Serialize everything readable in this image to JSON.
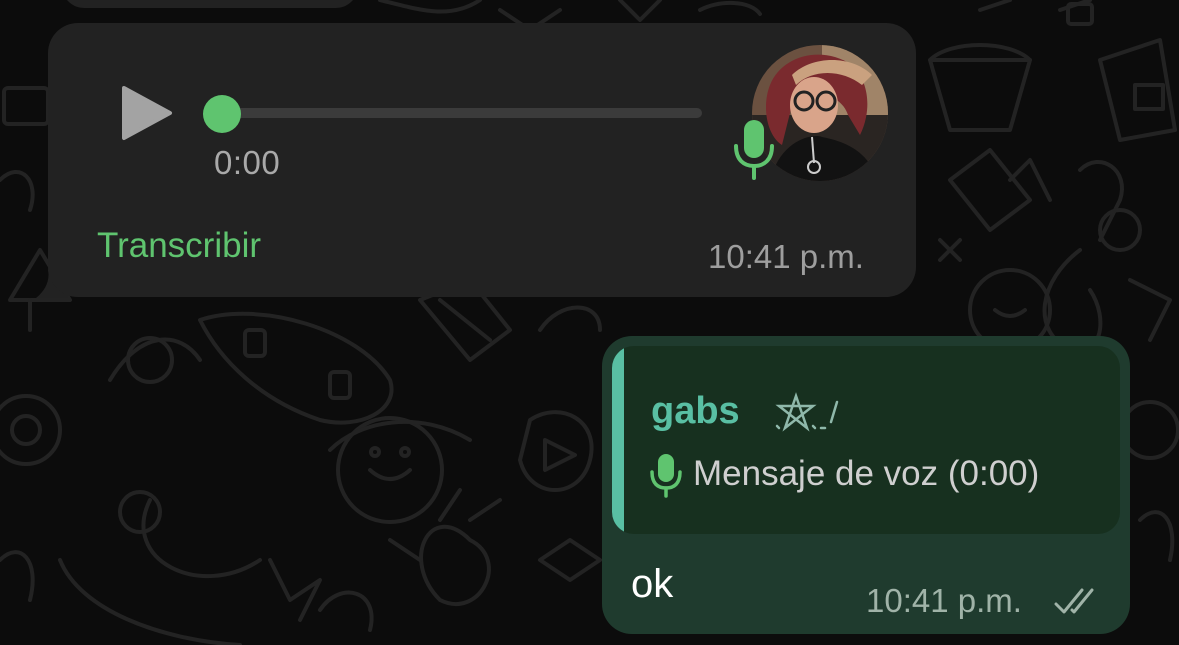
{
  "voice_message": {
    "duration": "0:00",
    "progress": 0,
    "transcribe_label": "Transcribir",
    "time": "10:41 p.m.",
    "play_icon": "play-icon",
    "mic_icon": "microphone-icon"
  },
  "reply_message": {
    "quote": {
      "sender": "gabs",
      "text": "Mensaje de voz (0:00)",
      "icon": "microphone-icon"
    },
    "text": "ok",
    "time": "10:41 p.m.",
    "status_icon": "double-check-icon"
  },
  "colors": {
    "accent_green": "#5fc46f",
    "quote_accent": "#59bfa3",
    "incoming_bubble": "#222222",
    "outgoing_bubble": "#1f3b2e",
    "background": "#0c0c0c"
  }
}
